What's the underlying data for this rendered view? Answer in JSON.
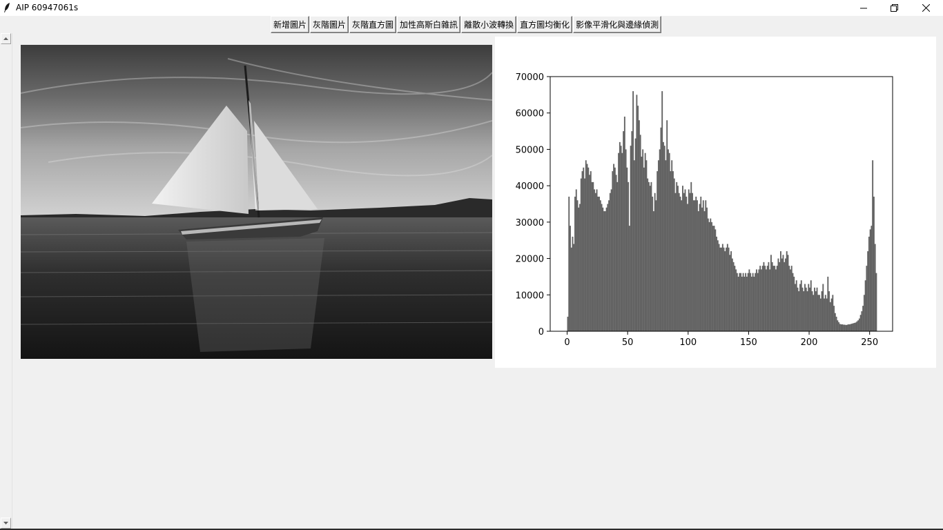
{
  "window": {
    "title": "AIP 60947061s",
    "icon": "feather-icon",
    "controls": [
      "minimize-icon",
      "restore-icon",
      "close-icon"
    ]
  },
  "toolbar": {
    "buttons": [
      {
        "label": "新增圖片"
      },
      {
        "label": "灰階圖片"
      },
      {
        "label": "灰階直方圖"
      },
      {
        "label": "加性高斯白雜訊"
      },
      {
        "label": "離散小波轉換"
      },
      {
        "label": "直方圖均衡化"
      },
      {
        "label": "影像平滑化與邊緣偵測"
      }
    ]
  },
  "scrollbar": {
    "up": "scroll-up-arrow-icon",
    "down": "scroll-down-arrow-icon"
  },
  "image": {
    "subject": "grayscale photo of a sailboat on water"
  },
  "chart_data": {
    "type": "bar",
    "title": "",
    "xlabel": "",
    "ylabel": "",
    "xlim": [
      -14,
      269
    ],
    "ylim": [
      0,
      70000
    ],
    "xticks": [
      0,
      50,
      100,
      150,
      200,
      250
    ],
    "yticks": [
      0,
      10000,
      20000,
      30000,
      40000,
      50000,
      60000,
      70000
    ],
    "grid": false,
    "bar_color": "#636363",
    "series": [
      {
        "bins": "0-255",
        "values": [
          4000,
          37000,
          29000,
          23000,
          26000,
          24000,
          37000,
          39000,
          36000,
          34000,
          35000,
          42000,
          44000,
          45000,
          42000,
          47000,
          46000,
          45000,
          43000,
          44000,
          41000,
          41000,
          39000,
          38000,
          39000,
          37000,
          37000,
          36000,
          35000,
          34000,
          33000,
          33000,
          34000,
          35000,
          36000,
          38000,
          39000,
          44000,
          46000,
          45000,
          43000,
          41000,
          49000,
          52000,
          51000,
          49000,
          55000,
          59000,
          50000,
          45000,
          41000,
          29000,
          51000,
          55000,
          66000,
          47000,
          53000,
          65000,
          62000,
          58000,
          54000,
          48000,
          50000,
          45000,
          49000,
          47000,
          42000,
          41000,
          40000,
          41000,
          37000,
          33000,
          38000,
          36000,
          44000,
          47000,
          50000,
          56000,
          66000,
          52000,
          51000,
          47000,
          58000,
          50000,
          49000,
          44000,
          47000,
          44000,
          42000,
          38000,
          41000,
          40000,
          38000,
          37000,
          36000,
          40000,
          38000,
          39000,
          37000,
          35000,
          39000,
          38000,
          41000,
          38000,
          36000,
          36000,
          37000,
          36000,
          33000,
          35000,
          37000,
          34000,
          36000,
          33000,
          36000,
          34000,
          31000,
          30000,
          31000,
          30000,
          29000,
          29000,
          28000,
          26000,
          25000,
          24000,
          23000,
          23000,
          24000,
          23000,
          22000,
          23000,
          24000,
          23000,
          21000,
          22000,
          20000,
          19000,
          18000,
          17000,
          16000,
          15000,
          16000,
          16000,
          15000,
          16000,
          15000,
          16000,
          15000,
          16000,
          17000,
          16000,
          15000,
          16000,
          15000,
          16000,
          17000,
          16000,
          17000,
          18000,
          17000,
          18000,
          19000,
          18000,
          17000,
          18000,
          19000,
          17000,
          21000,
          19000,
          18000,
          18000,
          17000,
          18000,
          20000,
          19000,
          22000,
          20000,
          21000,
          19000,
          20000,
          22000,
          21000,
          18000,
          17000,
          18000,
          16000,
          15000,
          13000,
          14000,
          12000,
          11000,
          13000,
          14000,
          12000,
          11000,
          13000,
          12000,
          11000,
          13000,
          12000,
          14000,
          11000,
          10000,
          12000,
          11000,
          12000,
          10000,
          10000,
          9000,
          11000,
          13000,
          9000,
          10000,
          9000,
          15000,
          11000,
          8000,
          9000,
          10000,
          7000,
          5000,
          4000,
          3000,
          2500,
          2000,
          1900,
          1900,
          1800,
          1800,
          1700,
          1800,
          1900,
          1900,
          2000,
          2100,
          2200,
          2300,
          2400,
          2700,
          3000,
          3500,
          4500,
          5500,
          7000,
          10000,
          14000,
          18000,
          22000,
          26000,
          28000,
          29000,
          47000,
          37000,
          24000,
          16000
        ]
      }
    ]
  }
}
